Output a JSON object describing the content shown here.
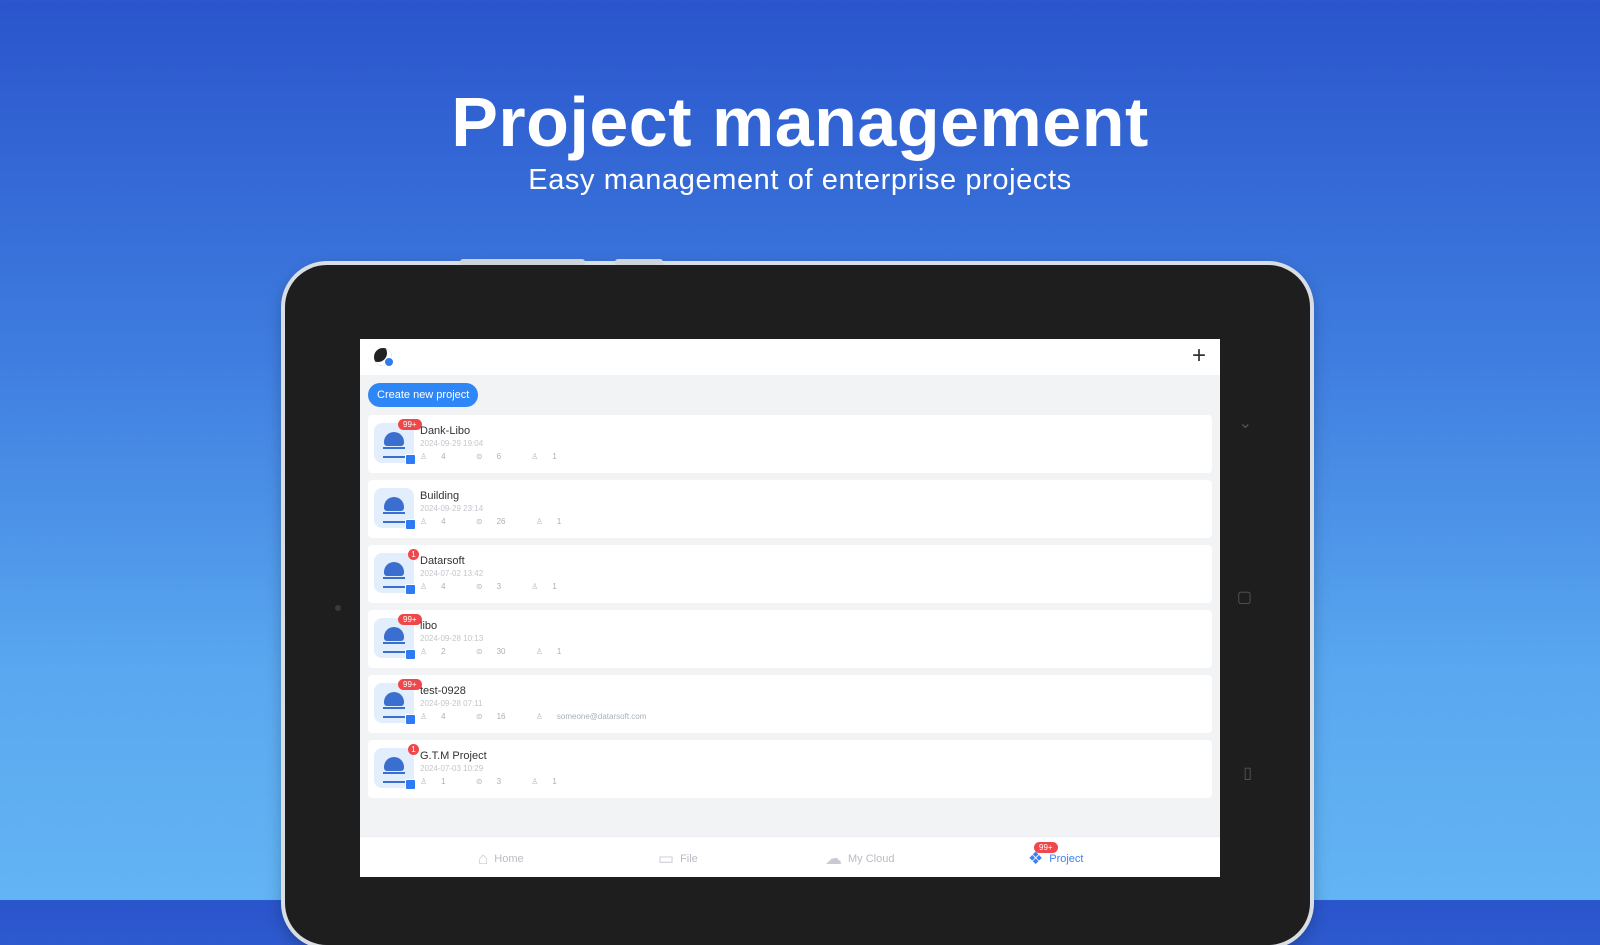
{
  "hero": {
    "title": "Project management",
    "subtitle": "Easy management of enterprise projects"
  },
  "app": {
    "create_button_label": "Create new project",
    "add_icon": "+",
    "projects": [
      {
        "name": "Dank-Libo",
        "date": "2024-09-29 19:04",
        "members": "4",
        "files": "6",
        "owner": "1",
        "badge": "99+"
      },
      {
        "name": "Building",
        "date": "2024-09-29 23:14",
        "members": "4",
        "files": "26",
        "owner": "1",
        "badge": ""
      },
      {
        "name": "Datarsoft",
        "date": "2024-07-02 13:42",
        "members": "4",
        "files": "3",
        "owner": "1",
        "badge": "1"
      },
      {
        "name": "libo",
        "date": "2024-09-28 10:13",
        "members": "2",
        "files": "30",
        "owner": "1",
        "badge": "99+"
      },
      {
        "name": "test-0928",
        "date": "2024-09-28 07:11",
        "members": "4",
        "files": "16",
        "owner": "someone@datarsoft.com",
        "badge": "99+"
      },
      {
        "name": "G.T.M Project",
        "date": "2024-07-03 10:29",
        "members": "1",
        "files": "3",
        "owner": "1",
        "badge": "1"
      }
    ],
    "nav": {
      "home": "Home",
      "file": "File",
      "cloud": "My Cloud",
      "project": "Project",
      "project_badge": "99+"
    }
  },
  "colors": {
    "accent": "#2f86f6",
    "badge": "#f0484a",
    "bg_top": "#2a55cc",
    "bg_bottom": "#62b4f4"
  }
}
